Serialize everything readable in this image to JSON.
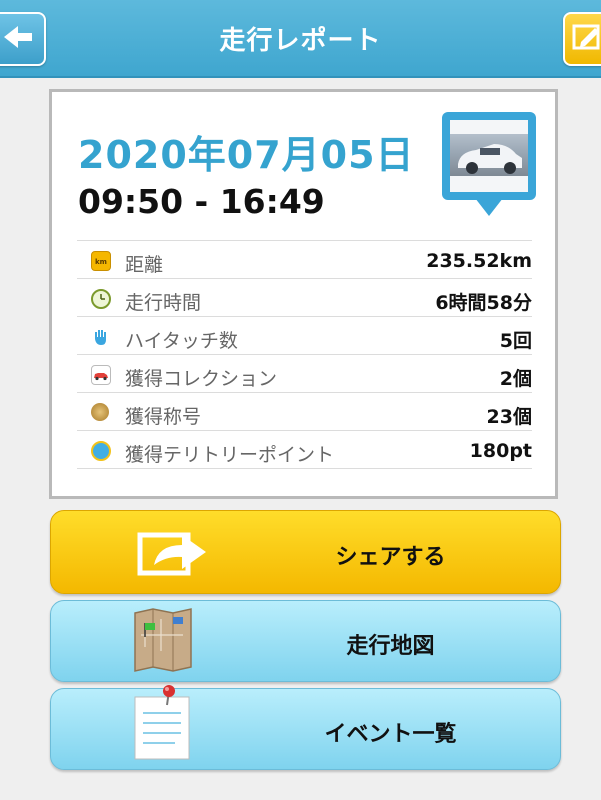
{
  "header": {
    "title": "走行レポート",
    "back_icon": "arrow-left-icon",
    "edit_icon": "edit-icon"
  },
  "report": {
    "date": "2020年07月05日",
    "time_range": "09:50 - 16:49",
    "stats": [
      {
        "icon": "km-icon",
        "label": "距離",
        "value": "235.52km"
      },
      {
        "icon": "clock-icon",
        "label": "走行時間",
        "value": "6時間58分"
      },
      {
        "icon": "hand-icon",
        "label": "ハイタッチ数",
        "value": "5回"
      },
      {
        "icon": "car-icon",
        "label": "獲得コレクション",
        "value": "2個"
      },
      {
        "icon": "medal-icon",
        "label": "獲得称号",
        "value": "23個"
      },
      {
        "icon": "spot-icon",
        "label": "獲得テリトリーポイント",
        "value": "180pt"
      }
    ]
  },
  "actions": {
    "share_label": "シェアする",
    "map_label": "走行地図",
    "events_label": "イベント一覧"
  },
  "colors": {
    "header": "#4fb2d8",
    "accent_date": "#35a3cf",
    "share_button": "#f9c800",
    "secondary_button": "#9fe0f4"
  }
}
